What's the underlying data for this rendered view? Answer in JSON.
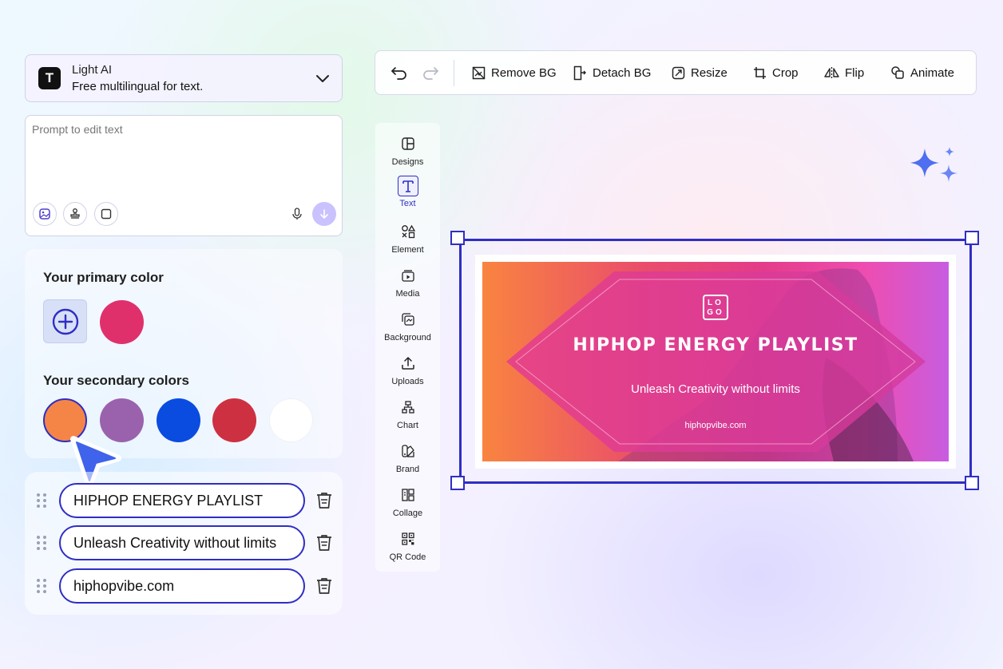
{
  "model": {
    "logo_letter": "T",
    "name": "Light AI",
    "description": "Free multilingual for text."
  },
  "prompt": {
    "placeholder": "Prompt to edit text",
    "value": ""
  },
  "colors": {
    "primary_heading": "Your primary color",
    "secondary_heading": "Your secondary colors",
    "primary": [
      "#e0306c"
    ],
    "secondary": [
      "#f58547",
      "#9a62ad",
      "#0a4ce0",
      "#cd3141",
      "#ffffff"
    ],
    "selected_secondary_index": 0
  },
  "text_fields": [
    {
      "value": "HIPHOP ENERGY PLAYLIST"
    },
    {
      "value": "Unleash Creativity without limits"
    },
    {
      "value": "hiphopvibe.com"
    }
  ],
  "toolbar": {
    "remove_bg": "Remove BG",
    "detach_bg": "Detach BG",
    "resize": "Resize",
    "crop": "Crop",
    "flip": "Flip",
    "animate": "Animate"
  },
  "rail": [
    {
      "label": "Designs",
      "icon": "designs-icon"
    },
    {
      "label": "Text",
      "icon": "text-icon",
      "active": true
    },
    {
      "label": "Element",
      "icon": "element-icon"
    },
    {
      "label": "Media",
      "icon": "media-icon"
    },
    {
      "label": "Background",
      "icon": "background-icon"
    },
    {
      "label": "Uploads",
      "icon": "uploads-icon"
    },
    {
      "label": "Chart",
      "icon": "chart-icon"
    },
    {
      "label": "Brand",
      "icon": "brand-icon"
    },
    {
      "label": "Collage",
      "icon": "collage-icon"
    },
    {
      "label": "QR Code",
      "icon": "qr-code-icon"
    }
  ],
  "banner": {
    "logo_line1": "LO",
    "logo_line2": "GO",
    "title": "HIPHOP ENERGY PLAYLIST",
    "subtitle": "Unleash Creativity without limits",
    "url": "hiphopvibe.com"
  },
  "accent_color": "#2f2ec4"
}
